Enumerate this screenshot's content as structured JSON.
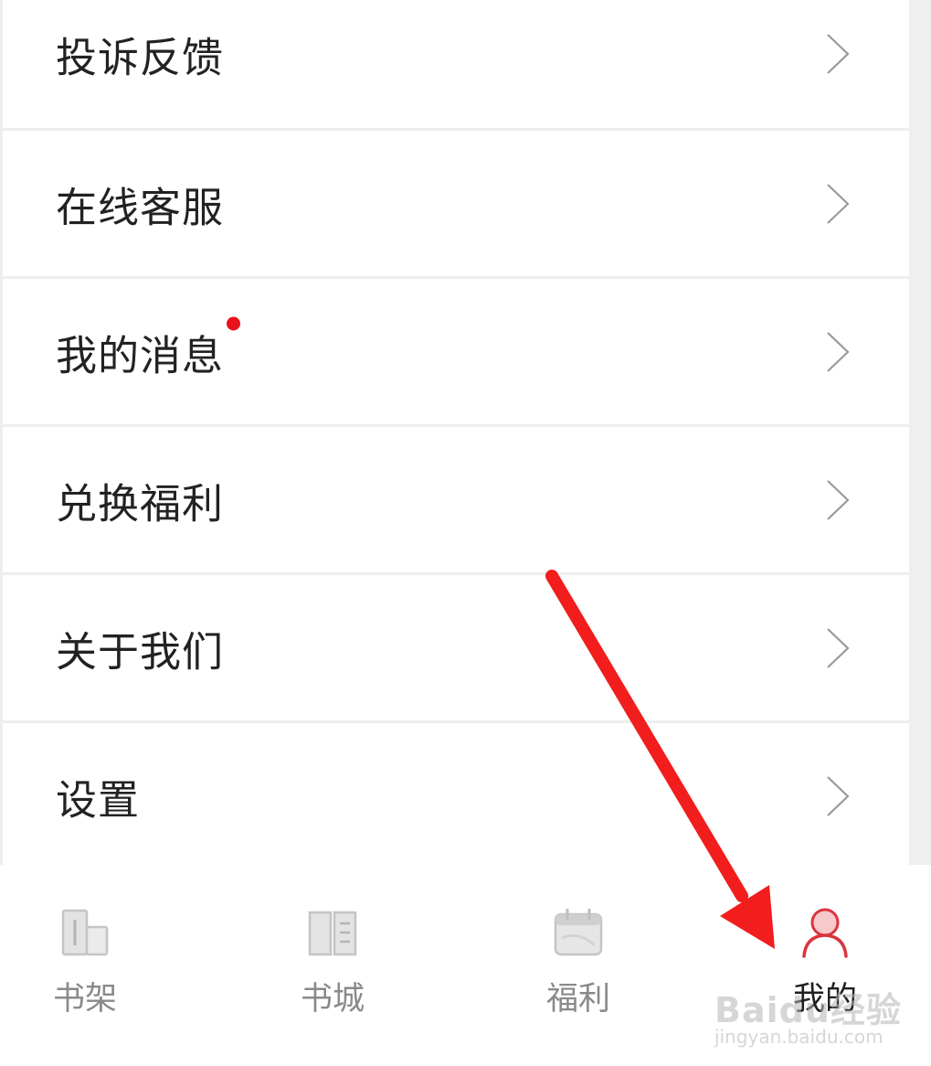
{
  "menu": {
    "items": [
      {
        "label": "投诉反馈",
        "has_badge": false
      },
      {
        "label": "在线客服",
        "has_badge": false
      },
      {
        "label": "我的消息",
        "has_badge": true
      },
      {
        "label": "兑换福利",
        "has_badge": false
      },
      {
        "label": "关于我们",
        "has_badge": false
      },
      {
        "label": "设置",
        "has_badge": false
      }
    ],
    "chevron_icon": "chevron-right-icon",
    "badge_color": "#e8131a"
  },
  "tabbar": {
    "active_index": 3,
    "items": [
      {
        "label": "书架",
        "icon": "bookshelf-icon"
      },
      {
        "label": "书城",
        "icon": "book-open-icon"
      },
      {
        "label": "福利",
        "icon": "calendar-icon"
      },
      {
        "label": "我的",
        "icon": "user-icon"
      }
    ],
    "inactive_color": "#8a8a8a",
    "active_color": "#d9363e"
  },
  "annotation": {
    "arrow_color": "#f21d1d",
    "points_to": "tab-mine"
  },
  "watermark": {
    "brand": "Baidu经验",
    "url": "jingyan.baidu.com"
  }
}
